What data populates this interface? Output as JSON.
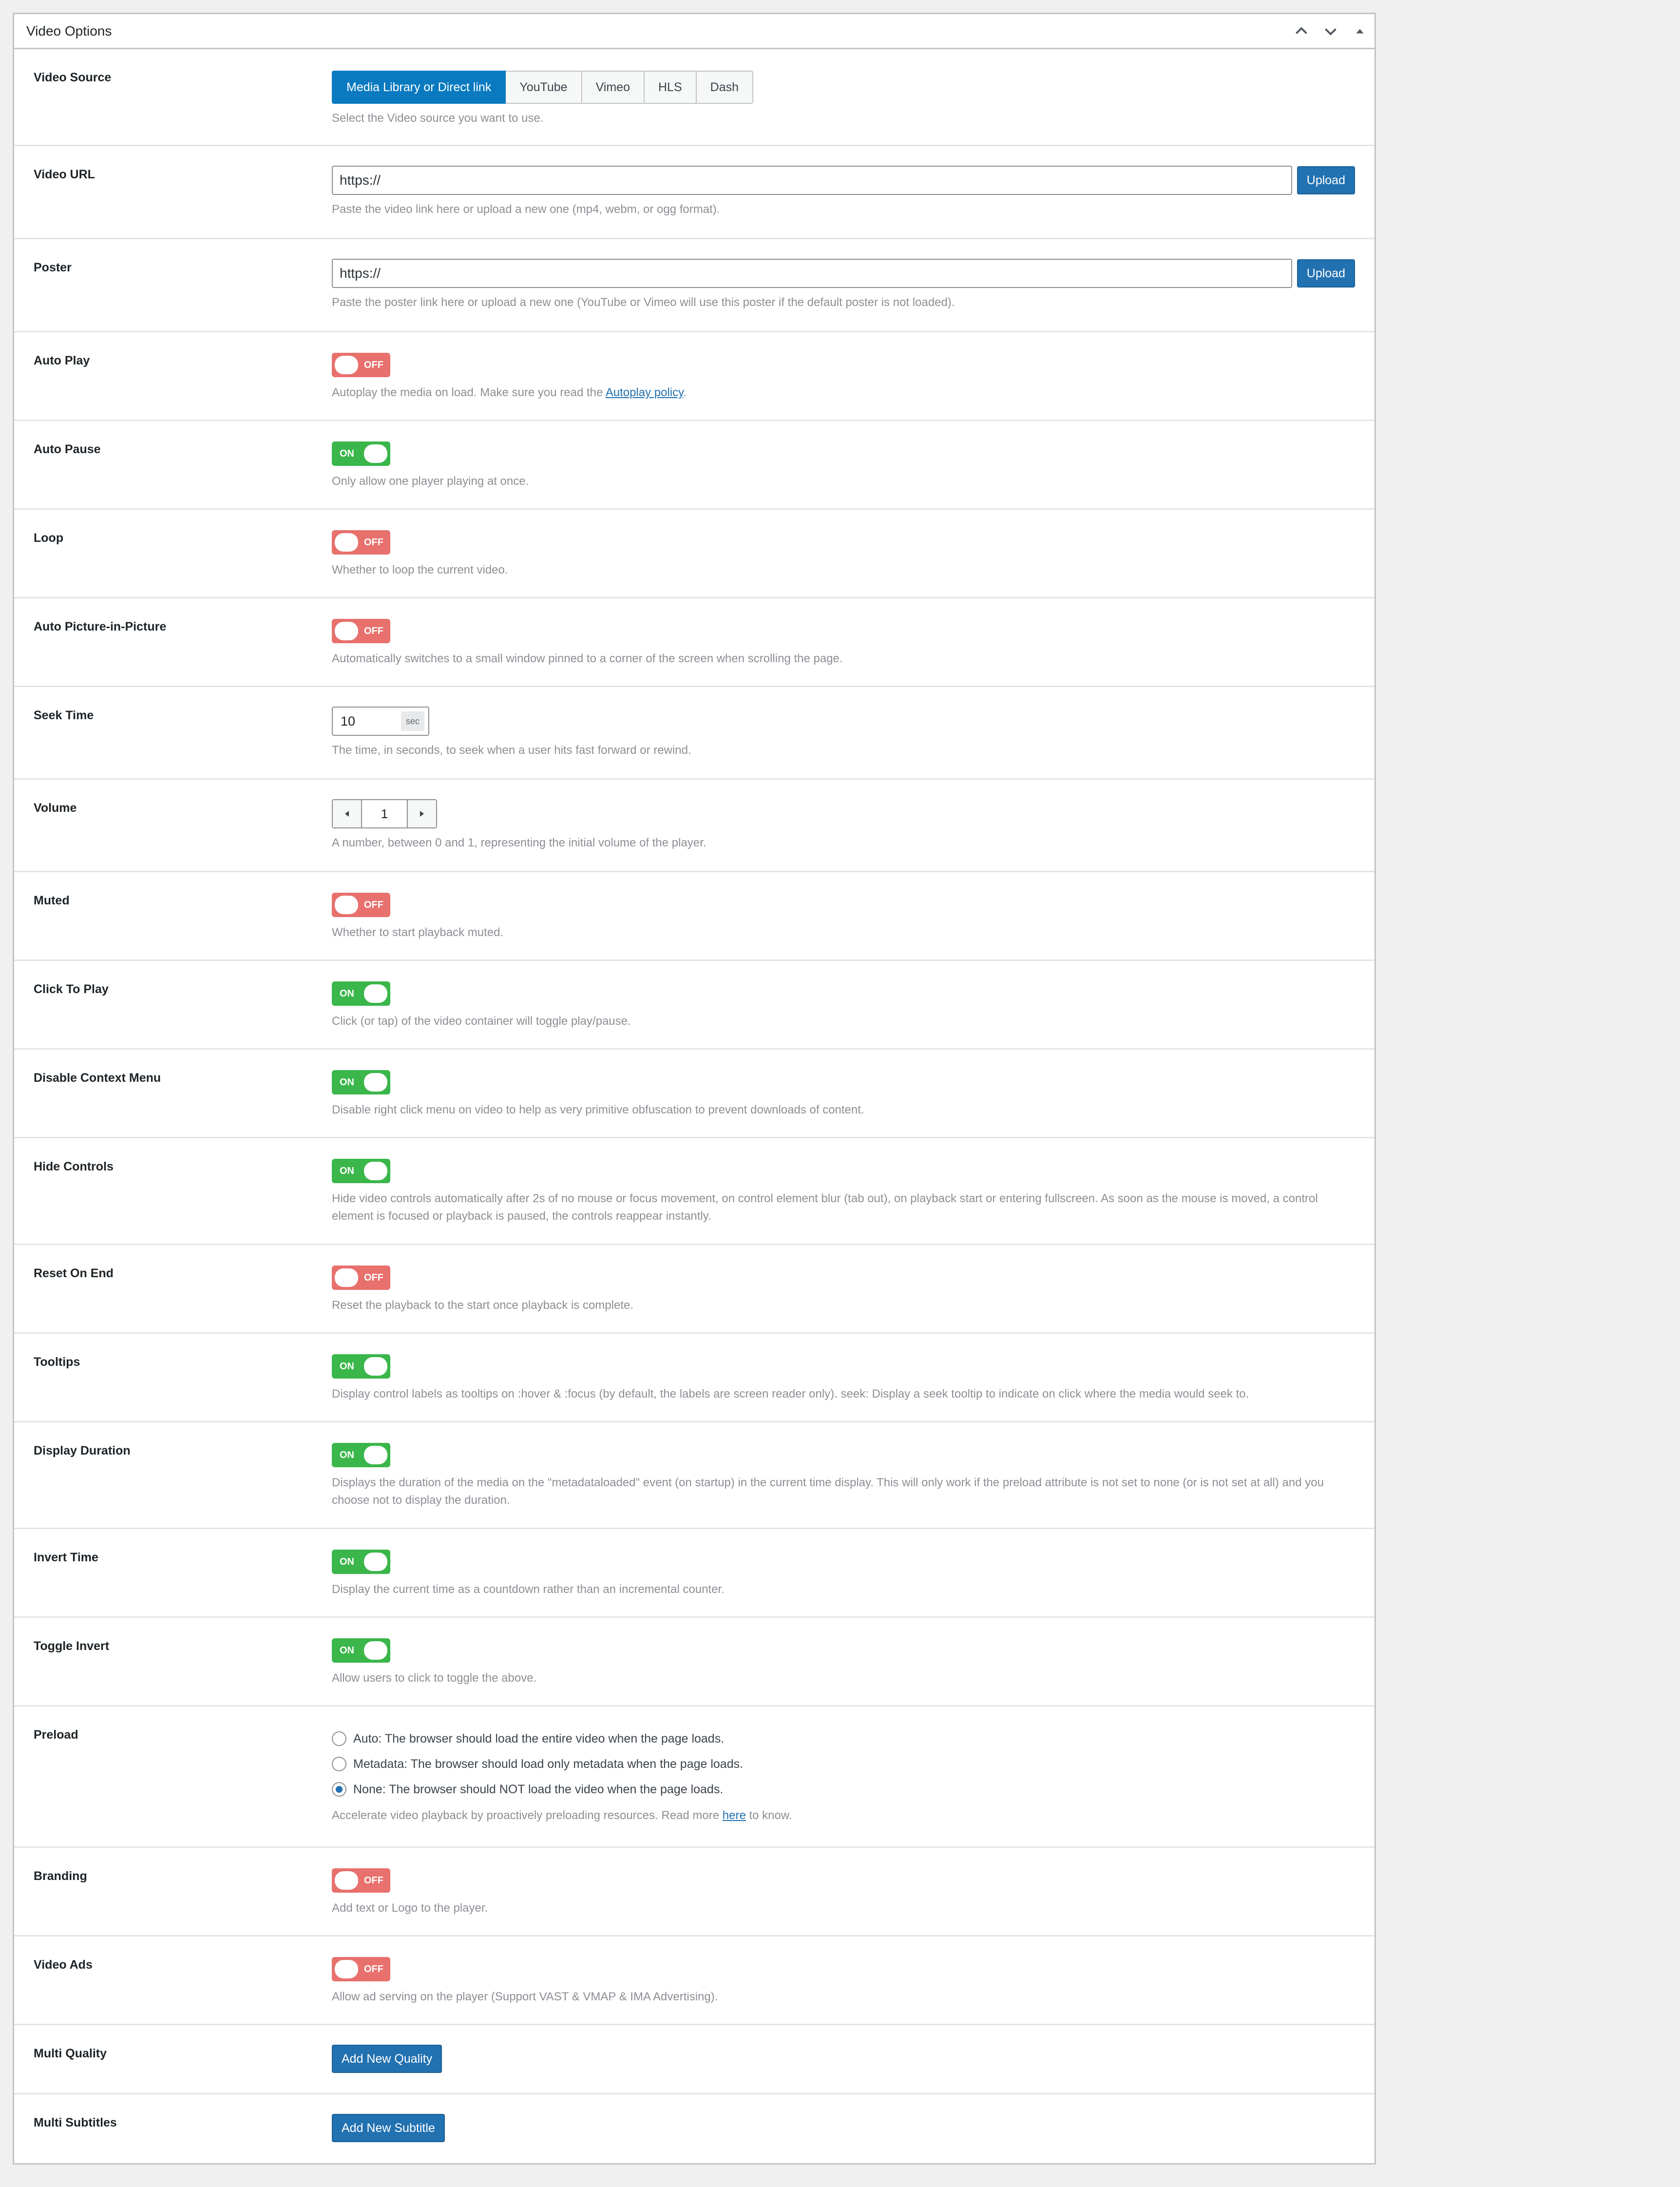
{
  "panel": {
    "title": "Video Options"
  },
  "video_source": {
    "label": "Video Source",
    "options": [
      "Media Library or Direct link",
      "YouTube",
      "Vimeo",
      "HLS",
      "Dash"
    ],
    "selected": "Media Library or Direct link",
    "desc": "Select the Video source you want to use."
  },
  "video_url": {
    "label": "Video URL",
    "value": "https://",
    "button": "Upload",
    "desc": "Paste the video link here or upload a new one (mp4, webm, or ogg format)."
  },
  "poster": {
    "label": "Poster",
    "value": "https://",
    "button": "Upload",
    "desc": "Paste the poster link here or upload a new one (YouTube or Vimeo will use this poster if the default poster is not loaded)."
  },
  "toggle_text": {
    "on": "ON",
    "off": "OFF"
  },
  "auto_play": {
    "label": "Auto Play",
    "state": "off",
    "desc_before": "Autoplay the media on load. Make sure you read the ",
    "link": "Autoplay policy",
    "desc_after": "."
  },
  "auto_pause": {
    "label": "Auto Pause",
    "state": "on",
    "desc": "Only allow one player playing at once."
  },
  "loop": {
    "label": "Loop",
    "state": "off",
    "desc": "Whether to loop the current video."
  },
  "auto_pip": {
    "label": "Auto Picture-in-Picture",
    "state": "off",
    "desc": "Automatically switches to a small window pinned to a corner of the screen when scrolling the page."
  },
  "seek_time": {
    "label": "Seek Time",
    "value": "10",
    "unit": "sec",
    "desc": "The time, in seconds, to seek when a user hits fast forward or rewind."
  },
  "volume": {
    "label": "Volume",
    "value": "1",
    "desc": "A number, between 0 and 1, representing the initial volume of the player."
  },
  "muted": {
    "label": "Muted",
    "state": "off",
    "desc": "Whether to start playback muted."
  },
  "click_to_play": {
    "label": "Click To Play",
    "state": "on",
    "desc": "Click (or tap) of the video container will toggle play/pause."
  },
  "disable_context_menu": {
    "label": "Disable Context Menu",
    "state": "on",
    "desc": "Disable right click menu on video to help as very primitive obfuscation to prevent downloads of content."
  },
  "hide_controls": {
    "label": "Hide Controls",
    "state": "on",
    "desc": "Hide video controls automatically after 2s of no mouse or focus movement, on control element blur (tab out), on playback start or entering fullscreen. As soon as the mouse is moved, a control element is focused or playback is paused, the controls reappear instantly."
  },
  "reset_on_end": {
    "label": "Reset On End",
    "state": "off",
    "desc": "Reset the playback to the start once playback is complete."
  },
  "tooltips": {
    "label": "Tooltips",
    "state": "on",
    "desc": "Display control labels as tooltips on :hover & :focus (by default, the labels are screen reader only). seek: Display a seek tooltip to indicate on click where the media would seek to."
  },
  "display_duration": {
    "label": "Display Duration",
    "state": "on",
    "desc": "Displays the duration of the media on the \"metadataloaded\" event (on startup) in the current time display. This will only work if the preload attribute is not set to none (or is not set at all) and you choose not to display the duration."
  },
  "invert_time": {
    "label": "Invert Time",
    "state": "on",
    "desc": "Display the current time as a countdown rather than an incremental counter."
  },
  "toggle_invert": {
    "label": "Toggle Invert",
    "state": "on",
    "desc": "Allow users to click to toggle the above."
  },
  "preload": {
    "label": "Preload",
    "options": [
      "Auto: The browser should load the entire video when the page loads.",
      "Metadata: The browser should load only metadata when the page loads.",
      "None: The browser should NOT load the video when the page loads."
    ],
    "selected_index": 2,
    "desc_before": "Accelerate video playback by proactively preloading resources. Read more ",
    "link": "here",
    "desc_after": " to know."
  },
  "branding": {
    "label": "Branding",
    "state": "off",
    "desc": "Add text or Logo to the player."
  },
  "video_ads": {
    "label": "Video Ads",
    "state": "off",
    "desc": "Allow ad serving on the player (Support VAST & VMAP & IMA Advertising)."
  },
  "multi_quality": {
    "label": "Multi Quality",
    "button": "Add New Quality"
  },
  "multi_subtitles": {
    "label": "Multi Subtitles",
    "button": "Add New Subtitle"
  }
}
